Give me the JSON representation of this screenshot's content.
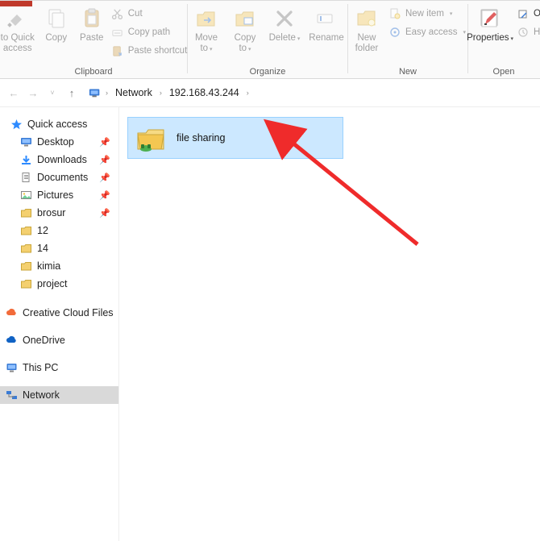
{
  "ribbon": {
    "pin_label": "to Quick access",
    "copy_label": "Copy",
    "paste_label": "Paste",
    "cut_label": "Cut",
    "copy_path_label": "Copy path",
    "paste_shortcut_label": "Paste shortcut",
    "clipboard_title": "Clipboard",
    "move_label": "Move to",
    "copy_to_label": "Copy to",
    "delete_label": "Delete",
    "rename_label": "Rename",
    "organize_title": "Organize",
    "new_folder_label": "New folder",
    "new_item_label": "New item",
    "easy_access_label": "Easy access",
    "new_title": "New",
    "properties_label": "Properties",
    "open_title": "Open",
    "side_o_label": "O",
    "side_h_label": "H"
  },
  "address": {
    "root": "Network",
    "ip": "192.168.43.244"
  },
  "sidebar": {
    "quick_access": "Quick access",
    "items": [
      {
        "label": "Desktop",
        "pinned": true
      },
      {
        "label": "Downloads",
        "pinned": true
      },
      {
        "label": "Documents",
        "pinned": true
      },
      {
        "label": "Pictures",
        "pinned": true
      },
      {
        "label": "brosur",
        "pinned": true
      },
      {
        "label": "12",
        "pinned": false
      },
      {
        "label": "14",
        "pinned": false
      },
      {
        "label": "kimia",
        "pinned": false
      },
      {
        "label": "project",
        "pinned": false
      }
    ],
    "creative_cloud": "Creative Cloud Files",
    "onedrive": "OneDrive",
    "this_pc": "This PC",
    "network": "Network"
  },
  "content": {
    "folder_name": "file sharing"
  }
}
